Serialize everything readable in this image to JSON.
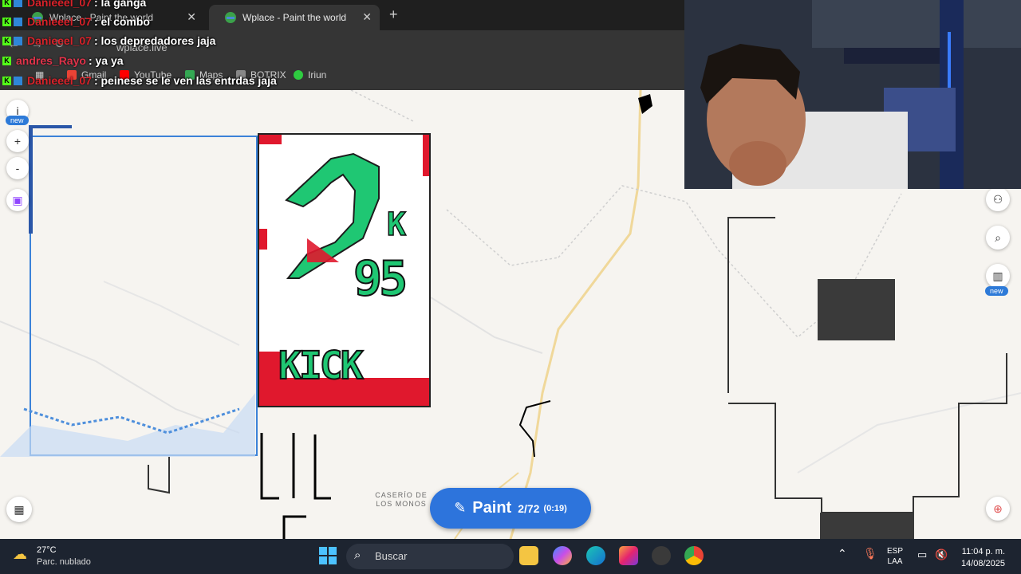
{
  "browser": {
    "tabs": [
      {
        "title": "Wplace - Paint the world",
        "close": "✕"
      },
      {
        "title": "Wplace - Paint the world",
        "close": "✕"
      }
    ],
    "new_tab": "+",
    "url": "wplace.live",
    "bookmarks": [
      "Gmail",
      "YouTube",
      "Maps",
      "BOTRIX",
      "Iriun"
    ]
  },
  "chat": [
    {
      "user": "Danieeel_07",
      "text": ": la ganga"
    },
    {
      "user": "Danieeel_07",
      "text": ": el combo"
    },
    {
      "user": "Danieeel_07",
      "text": ": los depredadores jaja"
    },
    {
      "user": "andres_Rayo",
      "text": ": ya ya"
    },
    {
      "user": "Danieeel_07",
      "text": ": peinese se le ven las entrdas jaja"
    }
  ],
  "map": {
    "left_controls": {
      "info": "i",
      "new_badge": "new",
      "zoom_in": "+",
      "zoom_out": "-"
    },
    "right_controls": {
      "new_badge": "new"
    },
    "place_label": "CASERÍO DE LOS MONOS",
    "paint_button": {
      "label": "Paint",
      "count": "2/72",
      "timer": "(0:19)"
    }
  },
  "artwork": {
    "top_text": "K",
    "number": "95",
    "bottom_text": "KICK",
    "lower_text": "LiL"
  },
  "taskbar": {
    "weather_temp": "27°C",
    "weather_desc": "Parc. nublado",
    "search_placeholder": "Buscar",
    "lang_top": "ESP",
    "lang_bottom": "LAA",
    "time": "11:04 p. m.",
    "date": "14/08/2025"
  },
  "colors": {
    "accent": "#2d74dc",
    "kick_green": "#53fc18",
    "art_green": "#1fc773",
    "art_red": "#e0182d"
  }
}
